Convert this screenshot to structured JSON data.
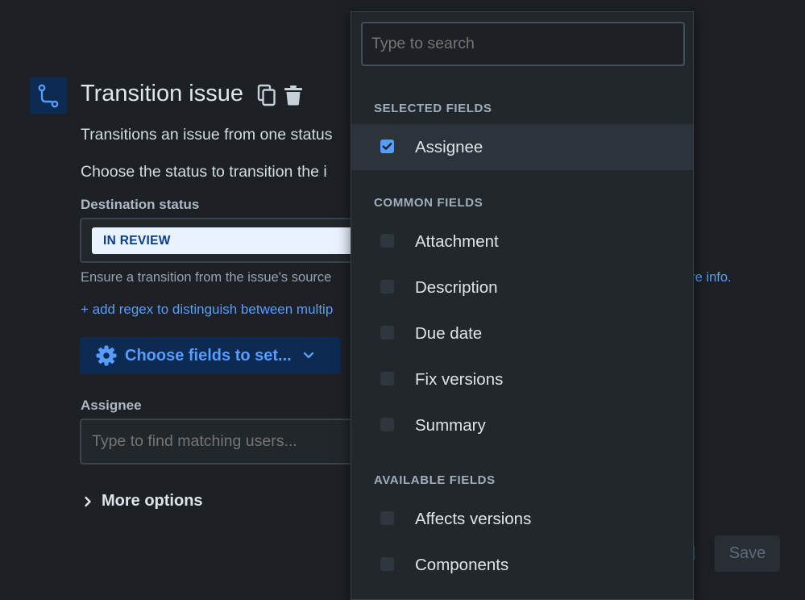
{
  "header": {
    "title": "Transition issue",
    "icon": "transition-icon",
    "accent_color": "#579dff"
  },
  "form": {
    "description_1": "Transitions an issue from one status",
    "description_2": "Choose the status to transition the i",
    "destination_label": "Destination status",
    "destination_value": "IN REVIEW",
    "helper_text": "Ensure a transition from the issue's source",
    "more_info_link": "ore info.",
    "regex_link": "+ add regex to distinguish between multip",
    "choose_fields_label": "Choose fields to set...",
    "assignee_label": "Assignee",
    "assignee_placeholder": "Type to find matching users...",
    "more_options_label": "More options",
    "save_label": "Save"
  },
  "dropdown": {
    "search_placeholder": "Type to search",
    "sections": [
      {
        "title": "SELECTED FIELDS",
        "items": [
          {
            "label": "Assignee",
            "checked": true
          }
        ]
      },
      {
        "title": "COMMON FIELDS",
        "items": [
          {
            "label": "Attachment",
            "checked": false
          },
          {
            "label": "Description",
            "checked": false
          },
          {
            "label": "Due date",
            "checked": false
          },
          {
            "label": "Fix versions",
            "checked": false
          },
          {
            "label": "Summary",
            "checked": false
          }
        ]
      },
      {
        "title": "AVAILABLE FIELDS",
        "items": [
          {
            "label": "Affects versions",
            "checked": false
          },
          {
            "label": "Components",
            "checked": false
          }
        ]
      }
    ]
  }
}
